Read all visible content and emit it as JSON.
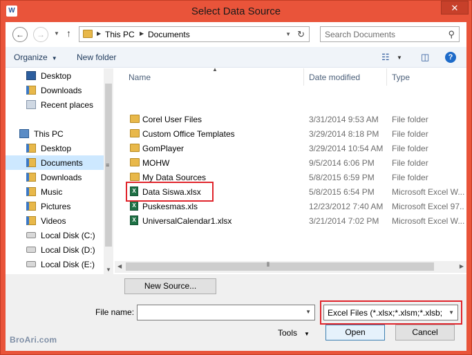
{
  "window": {
    "app_icon": "W",
    "title": "Select Data Source",
    "close_symbol": "✕"
  },
  "address": {
    "crumbs": [
      "This PC",
      "Documents"
    ]
  },
  "search": {
    "placeholder": "Search Documents"
  },
  "toolbar": {
    "organize": "Organize",
    "new_folder": "New folder"
  },
  "navpane": {
    "items": [
      {
        "label": "Desktop",
        "icon": "desktop-icon"
      },
      {
        "label": "Downloads",
        "icon": "downloads-folder-icon"
      },
      {
        "label": "Recent places",
        "icon": "recent-places-icon"
      },
      {
        "label": "This PC",
        "icon": "pc-icon"
      },
      {
        "label": "Desktop",
        "icon": "desktop-folder-icon"
      },
      {
        "label": "Documents",
        "icon": "documents-folder-icon",
        "selected": true
      },
      {
        "label": "Downloads",
        "icon": "downloads-folder-icon"
      },
      {
        "label": "Music",
        "icon": "music-folder-icon"
      },
      {
        "label": "Pictures",
        "icon": "pictures-folder-icon"
      },
      {
        "label": "Videos",
        "icon": "videos-folder-icon"
      },
      {
        "label": "Local Disk (C:)",
        "icon": "drive-icon"
      },
      {
        "label": "Local Disk (D:)",
        "icon": "drive-icon"
      },
      {
        "label": "Local Disk (E:)",
        "icon": "drive-icon"
      }
    ]
  },
  "columns": {
    "name": "Name",
    "date": "Date modified",
    "type": "Type"
  },
  "files": [
    {
      "name": "Corel User Files",
      "date": "3/31/2014 9:53 AM",
      "type": "File folder",
      "kind": "folder"
    },
    {
      "name": "Custom Office Templates",
      "date": "3/29/2014 8:18 PM",
      "type": "File folder",
      "kind": "folder"
    },
    {
      "name": "GomPlayer",
      "date": "3/29/2014 10:54 AM",
      "type": "File folder",
      "kind": "folder"
    },
    {
      "name": "MOHW",
      "date": "9/5/2014 6:06 PM",
      "type": "File folder",
      "kind": "folder"
    },
    {
      "name": "My Data Sources",
      "date": "5/8/2015 6:59 PM",
      "type": "File folder",
      "kind": "folder"
    },
    {
      "name": "Data Siswa.xlsx",
      "date": "5/8/2015 6:54 PM",
      "type": "Microsoft Excel W...",
      "kind": "excel"
    },
    {
      "name": "Puskesmas.xls",
      "date": "12/23/2012 7:40 AM",
      "type": "Microsoft Excel 97...",
      "kind": "excel"
    },
    {
      "name": "UniversalCalendar1.xlsx",
      "date": "3/21/2014 7:02 PM",
      "type": "Microsoft Excel W...",
      "kind": "excel"
    }
  ],
  "bottom": {
    "new_source": "New Source...",
    "file_name_label": "File name:",
    "file_name_value": "",
    "filter": "Excel Files (*.xlsx;*.xlsm;*.xlsb;*.xls)",
    "tools": "Tools",
    "open": "Open",
    "cancel": "Cancel"
  },
  "watermark": "BroAri.com",
  "colors": {
    "titlebar": "#e9543a",
    "highlight": "#e0242b",
    "selection": "#cde8ff"
  }
}
